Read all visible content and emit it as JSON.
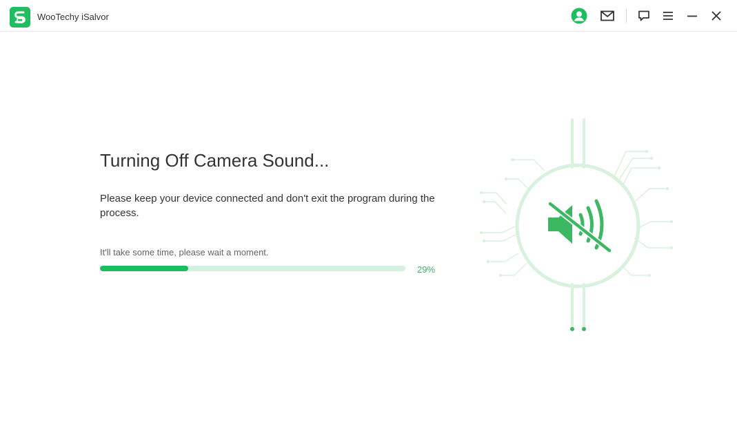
{
  "app": {
    "title": "WooTechy iSalvor"
  },
  "titlebar": {
    "icons": [
      "account-icon",
      "mail-icon",
      "feedback-icon",
      "menu-icon",
      "minimize-icon",
      "close-icon"
    ]
  },
  "main": {
    "heading": "Turning Off Camera Sound...",
    "description": "Please keep your device connected and don't exit the program during the process.",
    "hint": "It'll take some time, please wait a moment.",
    "progress_fraction": 0.29,
    "progress_label": "29%"
  },
  "colors": {
    "accent": "#1bbd5f",
    "accent_light": "#d3f1de",
    "icon_green": "#3cb863"
  }
}
